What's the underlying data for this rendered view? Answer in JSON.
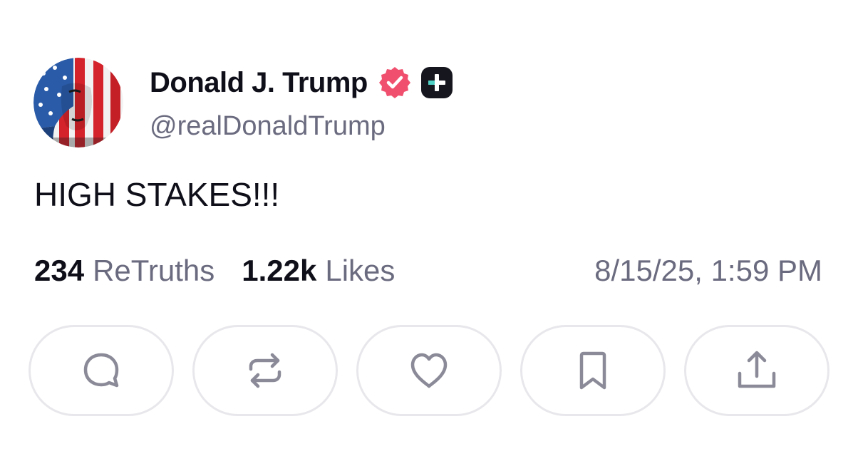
{
  "post": {
    "author": {
      "display_name": "Donald J. Trump",
      "handle": "@realDonaldTrump",
      "verified_icon": "verified-badge-icon",
      "plus_icon": "plus-badge-icon"
    },
    "text": "HIGH STAKES!!!",
    "stats": {
      "retruths_count": "234",
      "retruths_label": "ReTruths",
      "likes_count": "1.22k",
      "likes_label": "Likes"
    },
    "timestamp": "8/15/25, 1:59 PM"
  },
  "actions": [
    {
      "name": "reply",
      "icon": "comment-icon"
    },
    {
      "name": "retruth",
      "icon": "repost-icon"
    },
    {
      "name": "like",
      "icon": "heart-icon"
    },
    {
      "name": "bookmark",
      "icon": "bookmark-icon"
    },
    {
      "name": "share",
      "icon": "share-icon"
    }
  ],
  "colors": {
    "text_primary": "#0f0f1a",
    "text_secondary": "#6b6b80",
    "verified_badge": "#f0506e",
    "plus_badge_bg": "#16161f",
    "plus_badge_accent": "#4fd1c5",
    "icon_gray": "#8a8a98",
    "button_border": "#e8e8ec"
  }
}
